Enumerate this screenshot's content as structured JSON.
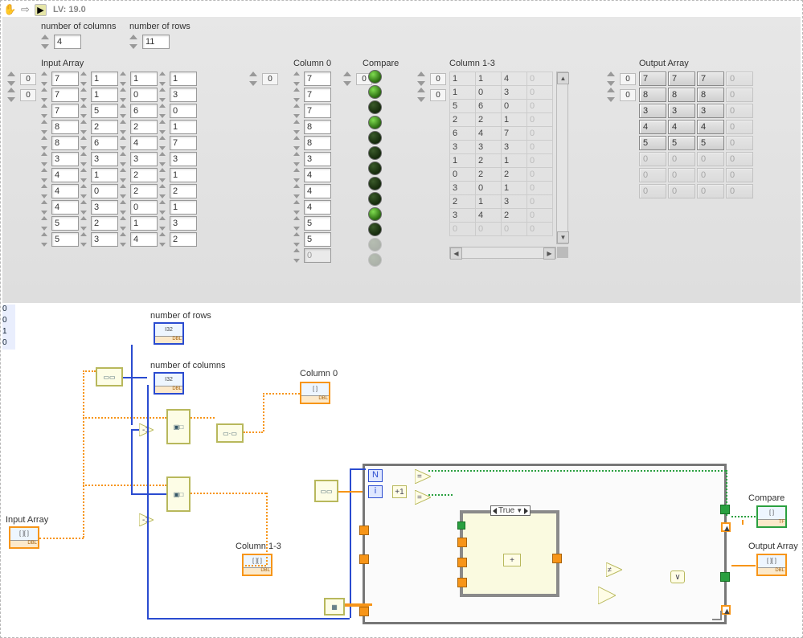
{
  "toolbar": {
    "hand": "✋",
    "arrow": "⇨",
    "run": "▶",
    "version_lbl": "LV: 19.0"
  },
  "fp": {
    "numcols_lbl": "number of columns",
    "numcols": "4",
    "numrows_lbl": "number of rows",
    "numrows": "11",
    "input_lbl": "Input Array",
    "input_idx": [
      "0",
      "0"
    ],
    "input": [
      [
        "7",
        "1",
        "1",
        "1"
      ],
      [
        "7",
        "1",
        "0",
        "3"
      ],
      [
        "7",
        "5",
        "6",
        "0"
      ],
      [
        "8",
        "2",
        "2",
        "1"
      ],
      [
        "8",
        "6",
        "4",
        "7"
      ],
      [
        "3",
        "3",
        "3",
        "3"
      ],
      [
        "4",
        "1",
        "2",
        "1"
      ],
      [
        "4",
        "0",
        "2",
        "2"
      ],
      [
        "4",
        "3",
        "0",
        "1"
      ],
      [
        "5",
        "2",
        "1",
        "3"
      ],
      [
        "5",
        "3",
        "4",
        "2"
      ]
    ],
    "col0_lbl": "Column 0",
    "col0_idx": "0",
    "col0": [
      "7",
      "7",
      "7",
      "8",
      "8",
      "3",
      "4",
      "4",
      "4",
      "5",
      "5",
      "0"
    ],
    "compare_lbl": "Compare",
    "compare_idx": "0",
    "compare_on": [
      true,
      true,
      false,
      true,
      false,
      false,
      false,
      false,
      false,
      true,
      false
    ],
    "compare_off": [
      2,
      4,
      5,
      6,
      7,
      8,
      10
    ],
    "col13_lbl": "Column 1-3",
    "col13_idx": [
      "0",
      "0"
    ],
    "col13": [
      [
        "1",
        "1",
        "4",
        "0"
      ],
      [
        "1",
        "0",
        "3",
        "0"
      ],
      [
        "5",
        "6",
        "0",
        "0"
      ],
      [
        "2",
        "2",
        "1",
        "0"
      ],
      [
        "6",
        "4",
        "7",
        "0"
      ],
      [
        "3",
        "3",
        "3",
        "0"
      ],
      [
        "1",
        "2",
        "1",
        "0"
      ],
      [
        "0",
        "2",
        "2",
        "0"
      ],
      [
        "3",
        "0",
        "1",
        "0"
      ],
      [
        "2",
        "1",
        "3",
        "0"
      ],
      [
        "3",
        "4",
        "2",
        "0"
      ],
      [
        "0",
        "0",
        "0",
        "0"
      ]
    ],
    "output_lbl": "Output Array",
    "output_idx": [
      "0",
      "0"
    ],
    "output": [
      [
        "7",
        "7",
        "7",
        "0"
      ],
      [
        "8",
        "8",
        "8",
        "0"
      ],
      [
        "3",
        "3",
        "3",
        "0"
      ],
      [
        "4",
        "4",
        "4",
        "0"
      ],
      [
        "5",
        "5",
        "5",
        "0"
      ],
      [
        "0",
        "0",
        "0",
        "0"
      ],
      [
        "0",
        "0",
        "0",
        "0"
      ],
      [
        "0",
        "0",
        "0",
        "0"
      ]
    ]
  },
  "bd": {
    "nrows_lbl": "number of rows",
    "ncols_lbl": "number of columns",
    "col0_lbl": "Column 0",
    "col13_lbl": "Column 1-3",
    "input_lbl": "Input Array",
    "output_lbl": "Output Array",
    "compare_lbl": "Compare",
    "const0": "0",
    "const1": "1",
    "const0b": "0",
    "const0c": "0",
    "case_label": "True",
    "n": "N",
    "i": "i"
  }
}
